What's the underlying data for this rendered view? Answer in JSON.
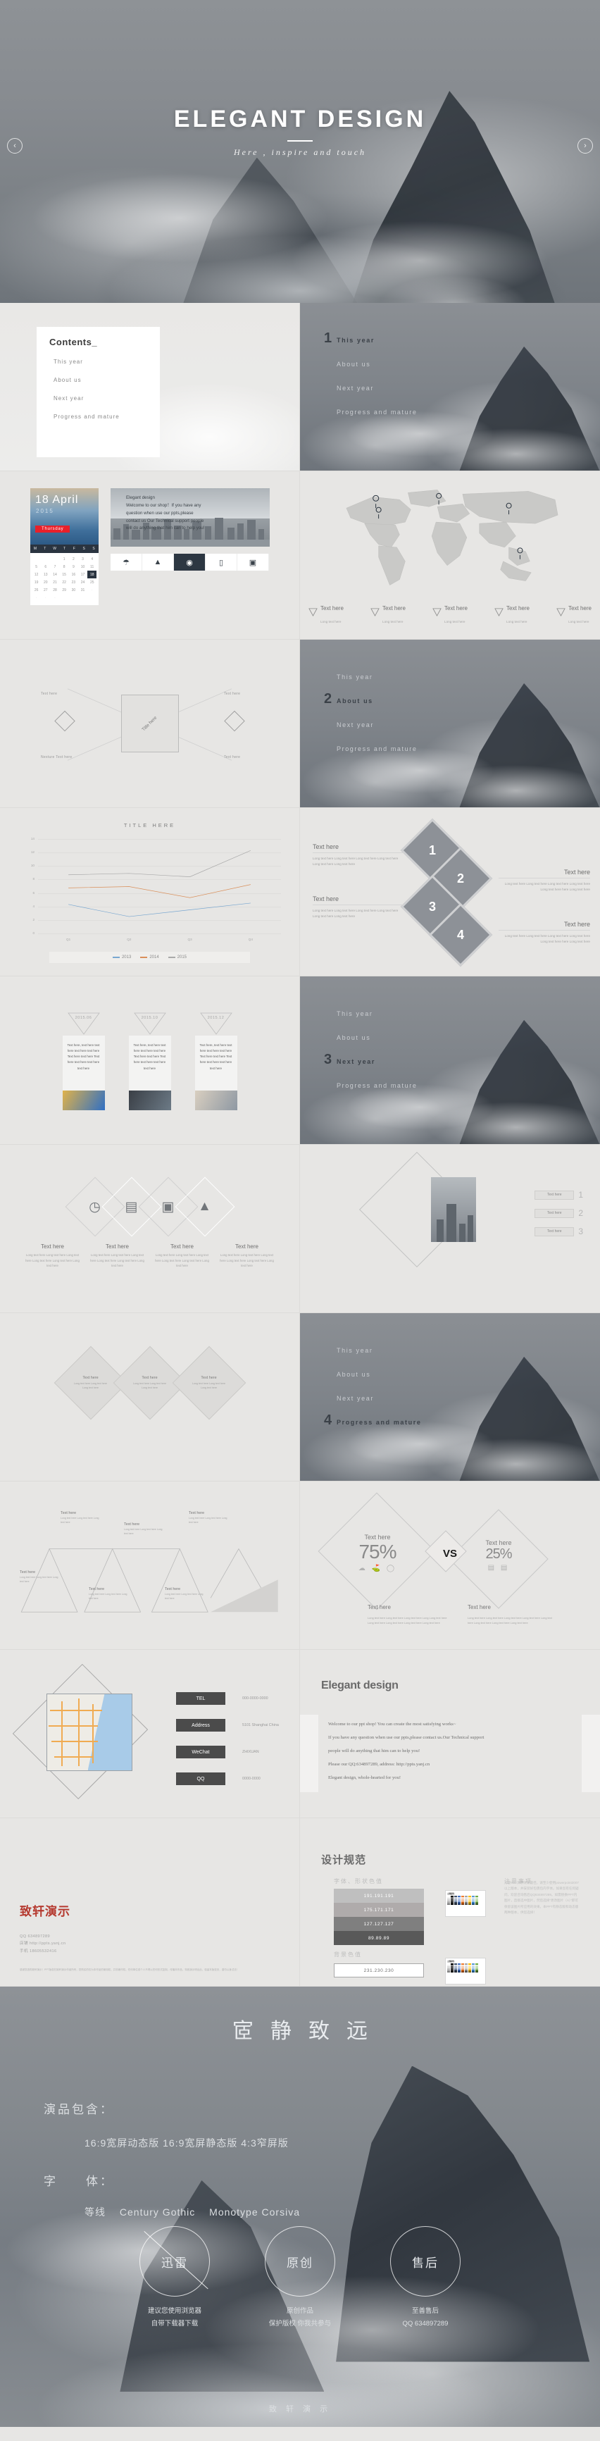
{
  "hero": {
    "title": "ELEGANT DESIGN",
    "subtitle": "Here ,  inspire and touch",
    "prev_icon": "‹",
    "next_icon": "›"
  },
  "agenda": {
    "items": [
      "This year",
      "About us",
      "Next year",
      "Progress and mature"
    ]
  },
  "contents": {
    "heading": "Contents_",
    "items": [
      "This year",
      "About us",
      "Next year",
      "Progress and mature"
    ]
  },
  "dividers": [
    {
      "number": "1",
      "active_index": 0
    },
    {
      "number": "2",
      "active_index": 1
    },
    {
      "number": "3",
      "active_index": 2
    },
    {
      "number": "4",
      "active_index": 3
    }
  ],
  "calendar_slide": {
    "day": "18 April",
    "year": "2015",
    "weekday": "Thursday",
    "dows": [
      "M",
      "T",
      "W",
      "T",
      "F",
      "S",
      "S"
    ],
    "days": [
      "1",
      "2",
      "3",
      "4",
      "5",
      "6",
      "7",
      "8",
      "9",
      "10",
      "11",
      "12",
      "13",
      "14",
      "15",
      "16",
      "17",
      "18",
      "19",
      "20",
      "21",
      "22",
      "23",
      "24",
      "25",
      "26",
      "27",
      "28",
      "29",
      "30",
      "31"
    ],
    "selected_day": "18",
    "body_lines": [
      "Elegant design",
      "Welcome to our shop！If you have any",
      "question when use our ppts,please",
      "contact us Our   Technical support people",
      "will do anything that him can to help you!"
    ],
    "icons": [
      "lamp-icon",
      "mountain-icon",
      "camera-icon",
      "laptop-icon",
      "printer-icon"
    ],
    "active_icon_index": 2
  },
  "world_map_slide": {
    "legend": [
      {
        "title": "Text here",
        "sub": "Long text here"
      },
      {
        "title": "Text here",
        "sub": "Long text here"
      },
      {
        "title": "Text here",
        "sub": "Long text here"
      },
      {
        "title": "Text here",
        "sub": "Long text here"
      },
      {
        "title": "Text here",
        "sub": "Long text here"
      }
    ]
  },
  "mindmap_slide": {
    "center": "Title here",
    "labels": [
      "Text here",
      "Text here",
      "Text here",
      "Text here"
    ],
    "bottom_label": "Nexture Text here"
  },
  "chart_data": {
    "type": "line",
    "title": "TITLE HERE",
    "categories": [
      "Q1",
      "Q2",
      "Q3",
      "Q4"
    ],
    "series": [
      {
        "name": "2013",
        "values": [
          4.3,
          2.5,
          3.5,
          4.5
        ],
        "color": "#79a7d0"
      },
      {
        "name": "2014",
        "values": [
          6.75,
          6.95,
          5.3,
          7.25
        ],
        "color": "#d98f5a"
      },
      {
        "name": "2015",
        "values": [
          8.7,
          8.9,
          8.4,
          12.3
        ],
        "color": "#a9a9a9"
      }
    ],
    "ylim": [
      0,
      14
    ],
    "yticks": [
      0,
      2,
      4,
      6,
      8,
      10,
      12,
      14
    ],
    "xlabel": "",
    "ylabel": "",
    "grid": true,
    "legend_position": "bottom"
  },
  "diamond_numbers_slide": {
    "blocks": [
      {
        "number": "1",
        "title": "Text here",
        "body": "Long text here  Long text here  Long text here  Long text here  Long text here  Long  text here",
        "align": "left"
      },
      {
        "number": "2",
        "title": "Text here",
        "body": "Long text here  Long text here  Long text here  Long  text here  Long text here  here  Long text here",
        "align": "right"
      },
      {
        "number": "3",
        "title": "Text here",
        "body": "Long text here  Long text here  Long text here  Long text here  Long text here  Long  text here",
        "align": "left"
      },
      {
        "number": "4",
        "title": "Text here",
        "body": "Long text here  Long text here  Long text here  Long  text here  Long text here  here  Long text here",
        "align": "right"
      }
    ]
  },
  "timeline_slide": {
    "cards": [
      {
        "date": "2015.06",
        "body": "Text here, text here text here text here text here Text here text here Text here text here text here text here"
      },
      {
        "date": "2015.10",
        "body": "Text here, text here text here text here text here Text here text here Text here text here text here text here"
      },
      {
        "date": "2015.12",
        "body": "Text here, text here text here text here text here Text here text here Text here text here text here text here"
      }
    ]
  },
  "icons_slide": {
    "items": [
      {
        "icon": "clock-icon",
        "glyph": "◴",
        "title": "Text here",
        "body": "Long text here  Long text here  Long text here  Long text here  Long text here  Long text here"
      },
      {
        "icon": "wallet-icon",
        "glyph": "⌸",
        "title": "Text here",
        "body": "Long text here  Long text here  Long text here  Long text here  Long text here  Long text here"
      },
      {
        "icon": "monitor-icon",
        "glyph": "▣",
        "title": "Text here",
        "body": "Long text here  Long text here  Long text here  Long text here  Long text here  Long text here"
      },
      {
        "icon": "mountain-icon",
        "glyph": "▲",
        "title": "Text here",
        "body": "Long text here  Long text here  Long text here  Long text here  Long text here  Long text here"
      }
    ]
  },
  "photo_list_slide": {
    "rows": [
      {
        "number": "1",
        "label": "Text here"
      },
      {
        "number": "2",
        "label": "Text here"
      },
      {
        "number": "3",
        "label": "Text here"
      }
    ]
  },
  "trio_slide": {
    "items": [
      {
        "title": "Text here",
        "body": "Long text here Long text here Long text here"
      },
      {
        "title": "Text here",
        "body": "Long text here Long text here Long text here"
      },
      {
        "title": "Text here",
        "body": "Long text here Long text here Long text here"
      }
    ]
  },
  "fishbone_slide": {
    "items": [
      {
        "title": "Text here",
        "body": "Long text here Long text here Long text here"
      },
      {
        "title": "Text here",
        "body": "Long text here Long text here Long text here"
      },
      {
        "title": "Text here",
        "body": "Long text here Long text here Long text here"
      },
      {
        "title": "Text here",
        "body": "Long text here Long text here Long text here"
      },
      {
        "title": "Text here",
        "body": "Long text here Long text here Long text here"
      },
      {
        "title": "Text here",
        "body": "Long text here Long text here Long text here"
      }
    ]
  },
  "vs_slide": {
    "left": {
      "title": "Text here",
      "percent": "75%",
      "icons": "☁ Ὥ2 ○"
    },
    "right": {
      "title": "Text here",
      "percent": "25%",
      "icons": "⌸ ▤"
    },
    "vs_label": "VS",
    "footers": [
      {
        "title": "Text here",
        "body": "Long text here  Long text here  Long text here  Long Long text here  Long text here Long text here  Long text here Long text here"
      },
      {
        "title": "Text here",
        "body": "Long text here  Long text here  Long text here  Long text here  Long text here Long text here  Long text here Long text here"
      }
    ]
  },
  "contact_slide": {
    "rows": [
      {
        "key": "TEL",
        "value": "000-0000-0000"
      },
      {
        "key": "Address",
        "value": "5101 Shanghai China"
      },
      {
        "key": "WeChat",
        "value": "ZHIXUAN"
      },
      {
        "key": "QQ",
        "value": "0000-0000"
      }
    ]
  },
  "elegant_text_slide": {
    "heading": "Elegant design",
    "paragraphs": [
      "Welcome to our ppt shop! You can create the most satisfying works~",
      "If you have any question when use our ppts,please contact us.Our   Technical support",
      "people will do anything that him can to help you!",
      "Please our QQ:634897289,  address: http://ppts.yanj.cn",
      "Elegant design, whole-hearted  for you!"
    ]
  },
  "zhixuan_slide": {
    "title": "致轩演示",
    "lines": [
      "QQ   634897289",
      "店铺  http://ppts.yanj.cn",
      "手机  18605532416"
    ],
    "fine_print": "感谢您选购致轩演示！PPT版权归致轩演示作者所有，您购买的仅为本作品的使用权，并非著作权。任何单位或个人不得以任何形式复制、传播本作品，特致演示明出此。保留本版权页，谨勿以身试法！"
  },
  "design_spec_slide": {
    "title": "设计规范",
    "section_fonts": "字体、形状色值",
    "section_bg": "背景色值",
    "section_notes": "注意事项",
    "palette_title": "主题颜色",
    "swatches": [
      {
        "label": "191.191.191",
        "hex": "#bfbfbf"
      },
      {
        "label": "175.171.171",
        "hex": "#afabab"
      },
      {
        "label": "127.127.127",
        "hex": "#7f7f7f"
      },
      {
        "label": "89.89.89",
        "hex": "#595959"
      }
    ],
    "bg_swatch": {
      "label": "231.230.230",
      "hex": "#e7e6e6"
    },
    "notes": "为使PPT演示效果最佳，请至少使用powerpoint2007以上版本，并安装好包裹包内字体。如果您有任何疑问，欢迎咨询售后QQ634897289。如需替换PPT内图片，直接选中图片，然后选择“更改图片（A）”即可保留该图片所应用的效果。本PPT有静态版和动态版两种版本，供您选择！"
  },
  "promo": {
    "title": "宧静致远",
    "includes_key": "演品包含：",
    "includes_value": "16:9宽屏动态版   16:9宽屏静态版  4:3窄屏版",
    "fonts_key": "字　　体：",
    "fonts_value": "等线　 Century Gothic　 Monotype Corsiva",
    "circles": [
      {
        "label": "迅雷",
        "crossed": true,
        "caption": "建议您使用浏览器\n自带下载器下载"
      },
      {
        "label": "原创",
        "crossed": false,
        "caption": "原创作品\n保护版权 你我共参与"
      },
      {
        "label": "售后",
        "crossed": false,
        "caption": "至善售后\nQQ 634897289"
      }
    ],
    "footer": "致 轩 演 示"
  },
  "colors": {
    "page_bg": "#e7e6e4",
    "accent_red": "#b5392f",
    "dark": "#2d3742"
  }
}
